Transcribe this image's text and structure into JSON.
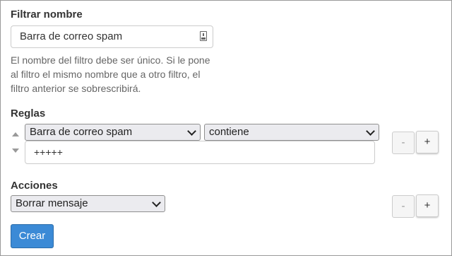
{
  "filter_name": {
    "label": "Filtrar nombre",
    "value": "Barra de correo spam",
    "icon": "password-manager-icon",
    "help_text": "El nombre del filtro debe ser único. Si le pone al filtro el mismo nombre que a otro filtro, el filtro anterior se sobrescribirá."
  },
  "rules": {
    "label": "Reglas",
    "field_select": "Barra de correo spam",
    "operator_select": "contiene",
    "value": "+++++",
    "minus_label": "-",
    "plus_label": "+"
  },
  "actions": {
    "label": "Acciones",
    "action_select": "Borrar mensaje",
    "minus_label": "-",
    "plus_label": "+"
  },
  "submit": {
    "label": "Crear"
  },
  "colors": {
    "primary": "#3b8ad6",
    "border": "#cccccc"
  }
}
